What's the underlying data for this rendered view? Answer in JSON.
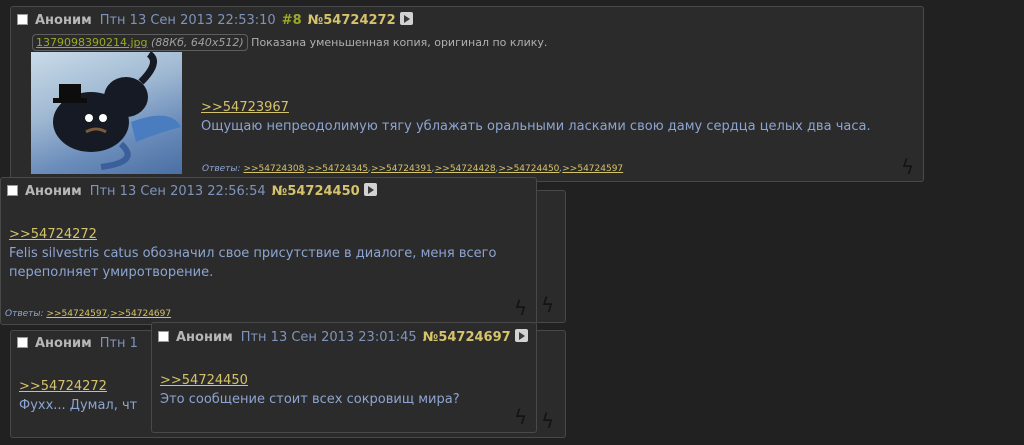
{
  "posts": {
    "op": {
      "name": "Аноним",
      "date": "Птн 13 Сен 2013 22:53:10",
      "index": "#8",
      "number": "№54724272",
      "file_name": "1379098390214.jpg",
      "file_meta": "(88Кб, 640x512)",
      "file_note": "Показана уменьшенная копия, оригинал по клику.",
      "quote": ">>54723967",
      "text": "Ощущаю непреодолимую тягу ублажать оральными ласками свою даму сердца целых два часа.",
      "replies_label": "Ответы:",
      "replies": [
        ">>54724308",
        ">>54724345",
        ">>54724391",
        ">>54724428",
        ">>54724450",
        ">>54724597"
      ]
    },
    "p450": {
      "name": "Аноним",
      "date": "Птн 13 Сен 2013 22:56:54",
      "number": "№54724450",
      "quote": ">>54724272",
      "text": "Felis silvestris catus обозначил свое присутствие в диалоге, меня всего переполняет умиротворение.",
      "replies_label": "Ответы:",
      "replies": [
        ">>54724597",
        ">>54724697"
      ]
    },
    "p697": {
      "name": "Аноним",
      "date": "Птн 13 Сен 2013 23:01:45",
      "number": "№54724697",
      "quote": ">>54724450",
      "text": "Это сообщение стоит всех сокровищ мира?"
    },
    "bg_post": {
      "name": "Аноним",
      "date_partial": "Птн 1",
      "quote": ">>54724272",
      "text_partial": "Фухх... Думал, чт"
    }
  },
  "colors": {
    "background": "#212121",
    "post_bg": "#2b2b2b",
    "border": "#494949",
    "name": "#b7b7b7",
    "text": "#8da5d2",
    "link": "#d5c36b",
    "index": "#9aaa27"
  }
}
